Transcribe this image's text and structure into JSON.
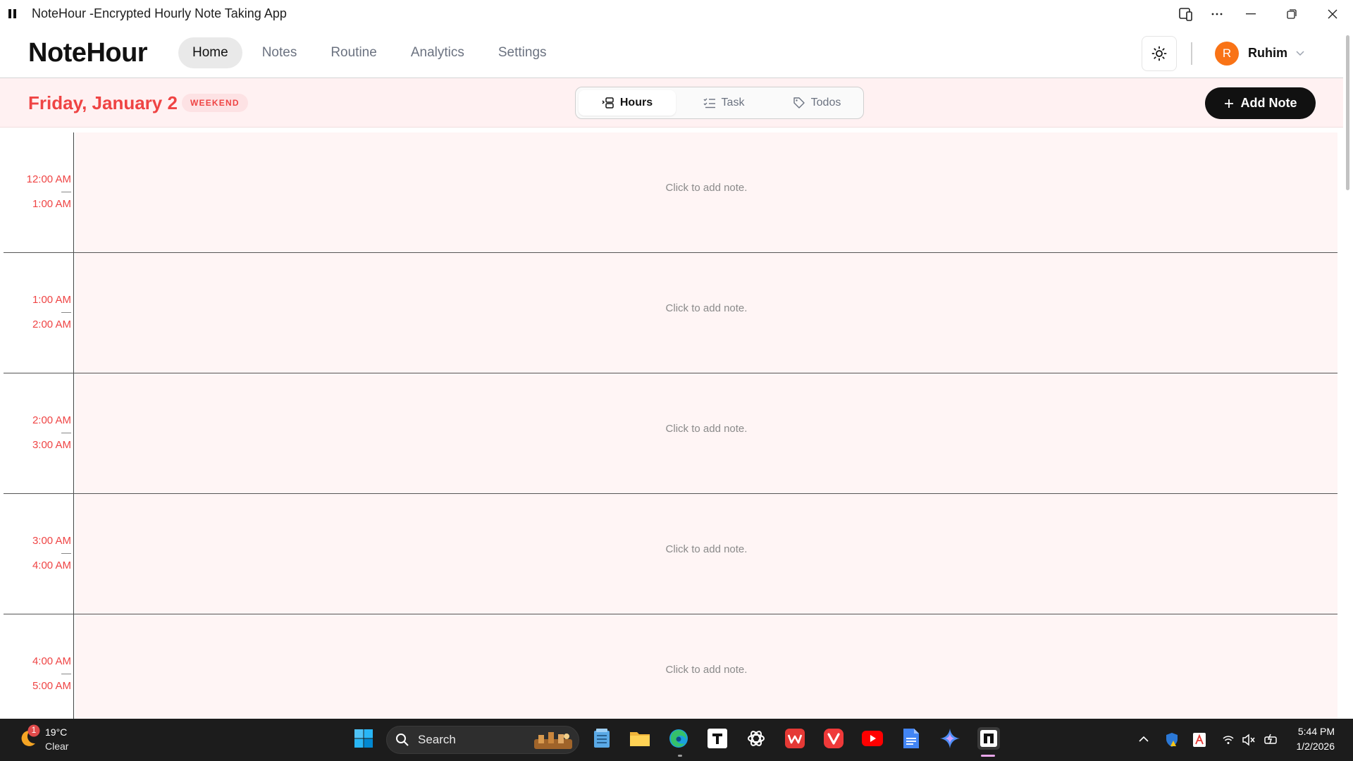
{
  "window": {
    "title": "NoteHour -Encrypted Hourly Note Taking App"
  },
  "header": {
    "logo": "NoteHour",
    "nav": [
      {
        "label": "Home",
        "active": true
      },
      {
        "label": "Notes",
        "active": false
      },
      {
        "label": "Routine",
        "active": false
      },
      {
        "label": "Analytics",
        "active": false
      },
      {
        "label": "Settings",
        "active": false
      }
    ],
    "theme_icon": "sun-icon",
    "user": {
      "initial": "R",
      "name": "Ruhim"
    }
  },
  "datebar": {
    "date": "Friday, January 2",
    "badge": "WEEKEND",
    "segments": [
      {
        "label": "Hours",
        "icon": "hours-icon",
        "active": true
      },
      {
        "label": "Task",
        "icon": "checklist-icon",
        "active": false
      },
      {
        "label": "Todos",
        "icon": "tag-icon",
        "active": false
      }
    ],
    "add_label": "Add Note"
  },
  "hours": [
    {
      "start": "12:00 AM",
      "end": "1:00 AM",
      "placeholder": "Click to add note."
    },
    {
      "start": "1:00 AM",
      "end": "2:00 AM",
      "placeholder": "Click to add note."
    },
    {
      "start": "2:00 AM",
      "end": "3:00 AM",
      "placeholder": "Click to add note."
    },
    {
      "start": "3:00 AM",
      "end": "4:00 AM",
      "placeholder": "Click to add note."
    },
    {
      "start": "4:00 AM",
      "end": "5:00 AM",
      "placeholder": "Click to add note."
    }
  ],
  "taskbar": {
    "weather": {
      "badge": "1",
      "temp": "19°C",
      "condition": "Clear"
    },
    "search_label": "Search",
    "clock": {
      "time": "5:44 PM",
      "date": "1/2/2026"
    }
  },
  "colors": {
    "accent": "#ef4444",
    "date_bar_bg": "#fff1f2",
    "note_bg": "#fff5f5",
    "avatar": "#f97316"
  }
}
